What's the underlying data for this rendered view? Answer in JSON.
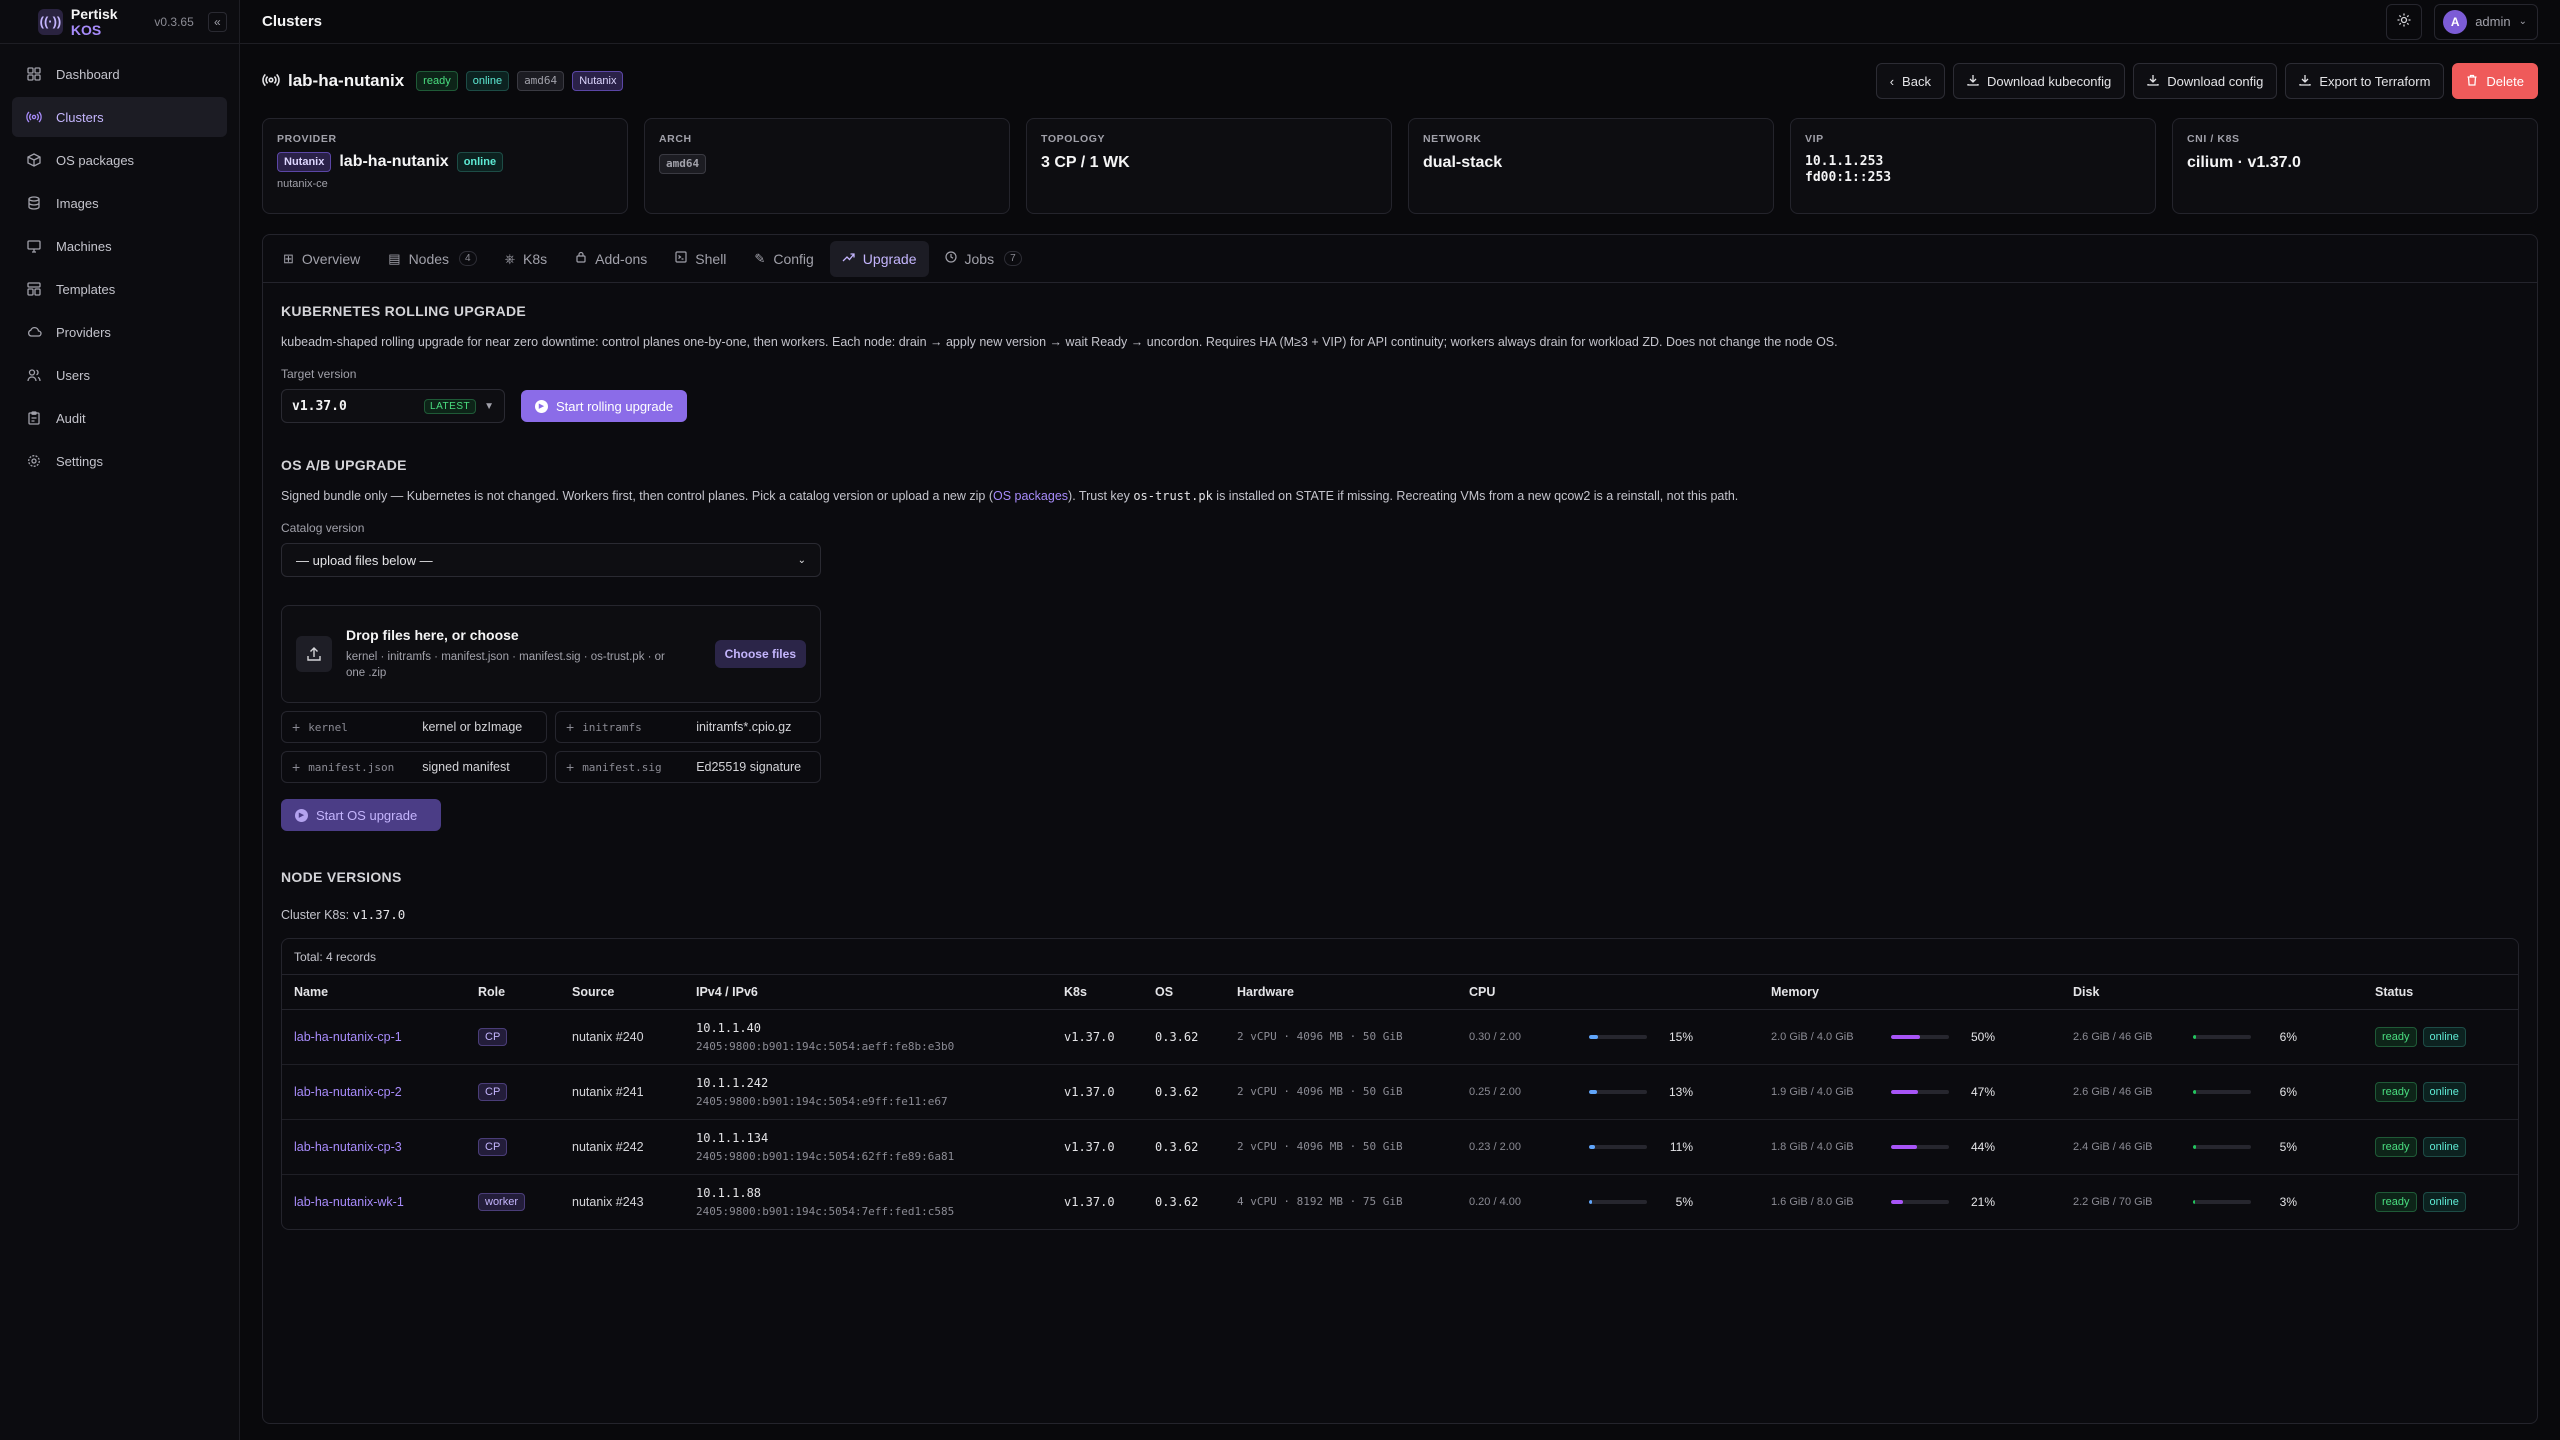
{
  "app": {
    "name": "Pertisk",
    "name_accent": "KOS",
    "version": "v0.3.65"
  },
  "sidebar": {
    "items": [
      {
        "label": "Dashboard",
        "icon": "dashboard-icon"
      },
      {
        "label": "Clusters",
        "icon": "clusters-icon",
        "active": true
      },
      {
        "label": "OS packages",
        "icon": "package-icon"
      },
      {
        "label": "Images",
        "icon": "database-icon"
      },
      {
        "label": "Machines",
        "icon": "monitor-icon"
      },
      {
        "label": "Templates",
        "icon": "templates-icon"
      },
      {
        "label": "Providers",
        "icon": "cloud-icon"
      },
      {
        "label": "Users",
        "icon": "users-icon"
      },
      {
        "label": "Audit",
        "icon": "clipboard-icon"
      },
      {
        "label": "Settings",
        "icon": "gear-icon"
      }
    ]
  },
  "topbar": {
    "title": "Clusters",
    "user": "admin",
    "avatar_initial": "A"
  },
  "cluster": {
    "name": "lab-ha-nutanix",
    "badges": [
      "ready",
      "online",
      "amd64",
      "Nutanix"
    ],
    "actions": {
      "back": "Back",
      "download_kubeconfig": "Download kubeconfig",
      "download_config": "Download config",
      "export": "Export to Terraform",
      "delete": "Delete"
    }
  },
  "cards": {
    "provider": {
      "label": "PROVIDER",
      "badge": "Nutanix",
      "name": "lab-ha-nutanix",
      "status": "online",
      "sub": "nutanix-ce"
    },
    "arch": {
      "label": "ARCH",
      "value": "amd64"
    },
    "topology": {
      "label": "TOPOLOGY",
      "value": "3 CP / 1 WK"
    },
    "network": {
      "label": "NETWORK",
      "value": "dual-stack"
    },
    "vip": {
      "label": "VIP",
      "v4": "10.1.1.253",
      "v6": "fd00:1::253"
    },
    "cni": {
      "label": "CNI / K8S",
      "value": "cilium · v1.37.0"
    }
  },
  "tabs": [
    {
      "label": "Overview",
      "icon": "grid-icon"
    },
    {
      "label": "Nodes",
      "icon": "server-icon",
      "count": "4"
    },
    {
      "label": "K8s",
      "icon": "helm-icon"
    },
    {
      "label": "Add-ons",
      "icon": "lock-icon"
    },
    {
      "label": "Shell",
      "icon": "terminal-icon"
    },
    {
      "label": "Config",
      "icon": "pencil-icon"
    },
    {
      "label": "Upgrade",
      "icon": "trend-icon",
      "active": true
    },
    {
      "label": "Jobs",
      "icon": "clock-icon",
      "count": "7"
    }
  ],
  "k8s_upgrade": {
    "title": "KUBERNETES ROLLING UPGRADE",
    "desc": "kubeadm-shaped rolling upgrade for near zero downtime: control planes one-by-one, then workers. Each node: drain → apply new version → wait Ready → uncordon. Requires HA (M≥3 + VIP) for API continuity; workers always drain for workload ZD. Does not change the node OS.",
    "target_label": "Target version",
    "target_value": "v1.37.0",
    "latest": "LATEST",
    "start": "Start rolling upgrade"
  },
  "os_upgrade": {
    "title": "OS A/B UPGRADE",
    "desc_pre": "Signed bundle only — Kubernetes is not changed. Workers first, then control planes. Pick a catalog version or upload a new zip (",
    "desc_link": "OS packages",
    "desc_mid": "). Trust key ",
    "desc_key": "os-trust.pk",
    "desc_post": " is installed on STATE if missing. Recreating VMs from a new qcow2 is a reinstall, not this path.",
    "catalog_label": "Catalog version",
    "catalog_value": "— upload files below —",
    "drop_title": "Drop files here, or choose",
    "drop_sub": "kernel · initramfs · manifest.json · manifest.sig · os-trust.pk · or one .zip",
    "choose": "Choose files",
    "slots": [
      {
        "key": "kernel",
        "desc": "kernel or bzImage"
      },
      {
        "key": "initramfs",
        "desc": "initramfs*.cpio.gz"
      },
      {
        "key": "manifest.json",
        "desc": "signed manifest"
      },
      {
        "key": "manifest.sig",
        "desc": "Ed25519 signature"
      }
    ],
    "start": "Start OS upgrade"
  },
  "node_versions": {
    "title": "NODE VERSIONS",
    "k8s_label": "Cluster K8s:",
    "k8s_value": "v1.37.0",
    "total": "Total: 4 records",
    "columns": [
      "Name",
      "Role",
      "Source",
      "IPv4 / IPv6",
      "K8s",
      "OS",
      "Hardware",
      "CPU",
      "Memory",
      "Disk",
      "Status"
    ],
    "rows": [
      {
        "name": "lab-ha-nutanix-cp-1",
        "role": "CP",
        "source": "nutanix #240",
        "ipv4": "10.1.1.40",
        "ipv6": "2405:9800:b901:194c:5054:aeff:fe8b:e3b0",
        "k8s": "v1.37.0",
        "os": "0.3.62",
        "hw": "2 vCPU · 4096 MB · 50 GiB",
        "cpu_text": "0.30 / 2.00",
        "cpu_pct": 15,
        "cpu_label": "15%",
        "mem_text": "2.0 GiB / 4.0 GiB",
        "mem_pct": 50,
        "mem_label": "50%",
        "disk_text": "2.6 GiB / 46 GiB",
        "disk_pct": 6,
        "disk_label": "6%",
        "status": [
          "ready",
          "online"
        ]
      },
      {
        "name": "lab-ha-nutanix-cp-2",
        "role": "CP",
        "source": "nutanix #241",
        "ipv4": "10.1.1.242",
        "ipv6": "2405:9800:b901:194c:5054:e9ff:fe11:e67",
        "k8s": "v1.37.0",
        "os": "0.3.62",
        "hw": "2 vCPU · 4096 MB · 50 GiB",
        "cpu_text": "0.25 / 2.00",
        "cpu_pct": 13,
        "cpu_label": "13%",
        "mem_text": "1.9 GiB / 4.0 GiB",
        "mem_pct": 47,
        "mem_label": "47%",
        "disk_text": "2.6 GiB / 46 GiB",
        "disk_pct": 6,
        "disk_label": "6%",
        "status": [
          "ready",
          "online"
        ]
      },
      {
        "name": "lab-ha-nutanix-cp-3",
        "role": "CP",
        "source": "nutanix #242",
        "ipv4": "10.1.1.134",
        "ipv6": "2405:9800:b901:194c:5054:62ff:fe89:6a81",
        "k8s": "v1.37.0",
        "os": "0.3.62",
        "hw": "2 vCPU · 4096 MB · 50 GiB",
        "cpu_text": "0.23 / 2.00",
        "cpu_pct": 11,
        "cpu_label": "11%",
        "mem_text": "1.8 GiB / 4.0 GiB",
        "mem_pct": 44,
        "mem_label": "44%",
        "disk_text": "2.4 GiB / 46 GiB",
        "disk_pct": 5,
        "disk_label": "5%",
        "status": [
          "ready",
          "online"
        ]
      },
      {
        "name": "lab-ha-nutanix-wk-1",
        "role": "worker",
        "source": "nutanix #243",
        "ipv4": "10.1.1.88",
        "ipv6": "2405:9800:b901:194c:5054:7eff:fed1:c585",
        "k8s": "v1.37.0",
        "os": "0.3.62",
        "hw": "4 vCPU · 8192 MB · 75 GiB",
        "cpu_text": "0.20 / 4.00",
        "cpu_pct": 5,
        "cpu_label": "5%",
        "mem_text": "1.6 GiB / 8.0 GiB",
        "mem_pct": 21,
        "mem_label": "21%",
        "disk_text": "2.2 GiB / 70 GiB",
        "disk_pct": 3,
        "disk_label": "3%",
        "status": [
          "ready",
          "online"
        ]
      }
    ]
  }
}
